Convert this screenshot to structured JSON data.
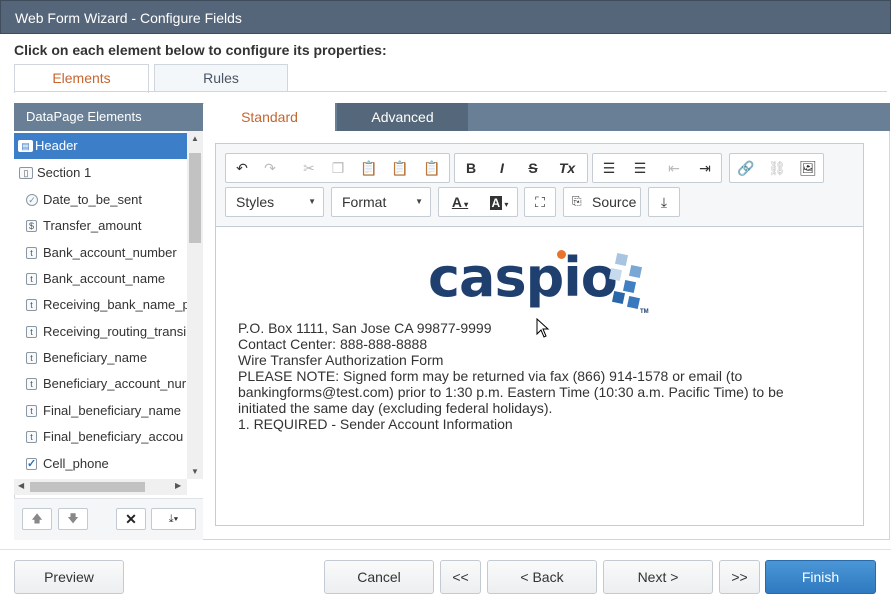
{
  "window": {
    "title": "Web Form Wizard - Configure Fields"
  },
  "instruction": "Click on each element below to configure its properties:",
  "top_tabs": [
    {
      "label": "Elements",
      "active": true
    },
    {
      "label": "Rules",
      "active": false
    }
  ],
  "left_panel": {
    "title": "DataPage Elements",
    "items": [
      {
        "label": "Header",
        "icon": "header-icon",
        "selected": true
      },
      {
        "label": "Section 1",
        "icon": "section-icon"
      },
      {
        "label": "Date_to_be_sent",
        "icon": "date-field-icon"
      },
      {
        "label": "Transfer_amount",
        "icon": "currency-field-icon"
      },
      {
        "label": "Bank_account_number",
        "icon": "text-field-icon"
      },
      {
        "label": "Bank_account_name",
        "icon": "text-field-icon"
      },
      {
        "label": "Receiving_bank_name_p",
        "icon": "text-field-icon"
      },
      {
        "label": "Receiving_routing_transi",
        "icon": "text-field-icon"
      },
      {
        "label": "Beneficiary_name",
        "icon": "text-field-icon"
      },
      {
        "label": "Beneficiary_account_nur",
        "icon": "text-field-icon"
      },
      {
        "label": "Final_beneficiary_name",
        "icon": "text-field-icon"
      },
      {
        "label": "Final_beneficiary_accou",
        "icon": "text-field-icon"
      },
      {
        "label": "Cell_phone",
        "icon": "checkbox-field-icon"
      }
    ]
  },
  "editor_tabs": [
    {
      "label": "Standard",
      "active": true
    },
    {
      "label": "Advanced",
      "active": false
    }
  ],
  "toolbar": {
    "styles_label": "Styles",
    "format_label": "Format",
    "source_label": "Source",
    "bold": "B",
    "italic": "I",
    "strike": "S",
    "remove_format": "Tx",
    "text_color": "A",
    "bg_color": "A"
  },
  "content": {
    "logo_text": "caspio",
    "logo_tm": "TM",
    "lines": [
      "P.O. Box 1111, San Jose CA 99877-9999",
      "Contact Center: 888-888-8888",
      "Wire Transfer Authorization Form",
      "PLEASE NOTE: Signed form may be returned via fax (866) 914-1578 or email (to",
      "bankingforms@test.com) prior to 1:30 p.m. Eastern Time (10:30 a.m. Pacific Time) to be",
      "initiated the same day (excluding federal holidays).",
      "1. REQUIRED - Sender Account Information"
    ]
  },
  "footer": {
    "preview": "Preview",
    "cancel": "Cancel",
    "first": "<<",
    "back": "< Back",
    "next": "Next >",
    "last": ">>",
    "finish": "Finish"
  },
  "colors": {
    "title_bar": "#55667a",
    "panel_header": "#687f95",
    "selected_item": "#3d7ec9",
    "active_tab_text": "#c7652f",
    "finish_button": "#3a87cb",
    "logo_blue": "#1f3f6e",
    "logo_orange": "#e8742c"
  }
}
